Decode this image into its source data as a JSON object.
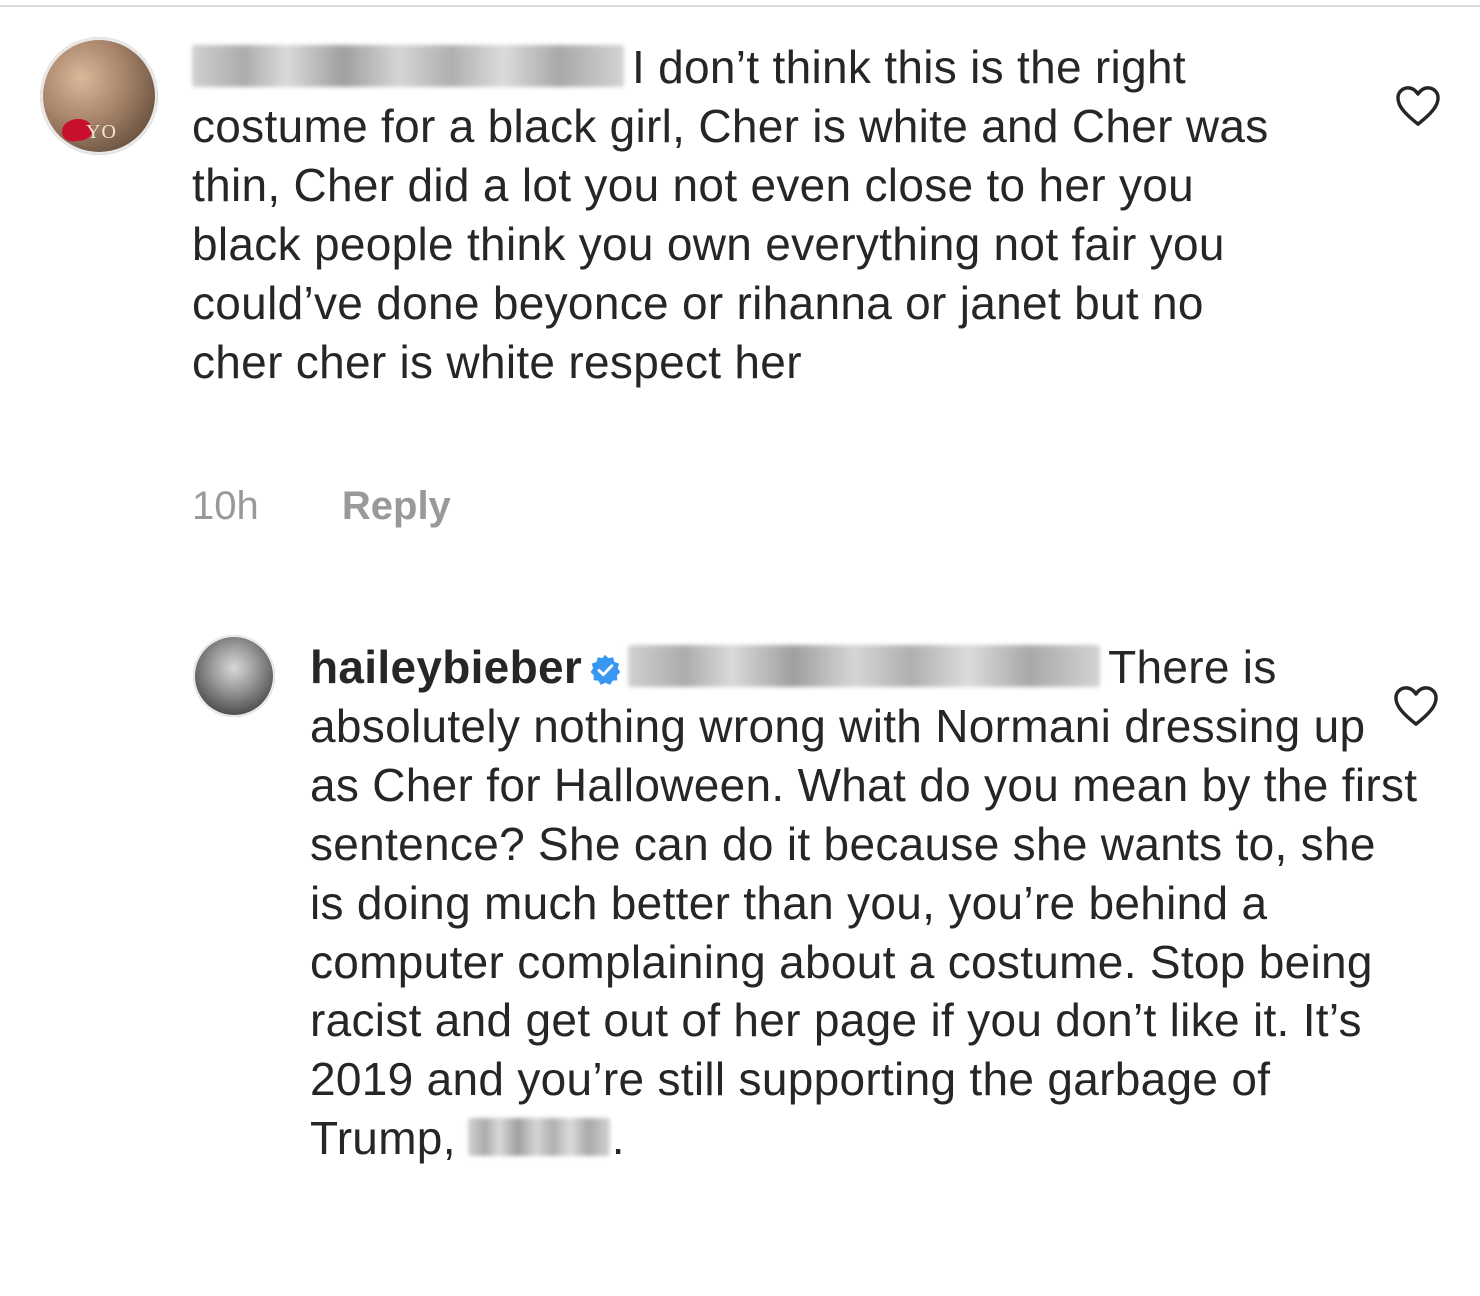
{
  "comments": [
    {
      "username_visible": "",
      "body": "I don’t think this is the right costume for a black girl, Cher is white and Cher was thin, Cher did a lot you not even close to her you black people think you own everything not fair you could’ve done beyonce or rihanna or janet but no cher cher is white respect her",
      "time": "10h",
      "reply_label": "Reply",
      "avatar_overlay_text": "YO"
    },
    {
      "username": "haileybieber",
      "verified": true,
      "body": "There is absolutely nothing wrong with Normani dressing up as Cher for Halloween. What do you mean by the first sentence? She can do it because she wants to, she is doing much better than you, you’re behind a computer complaining about a costume. Stop being racist and get out of her page if you don’t like it. It’s 2019 and you’re still supporting the garbage of Trump,",
      "body_end": "."
    }
  ],
  "colors": {
    "text": "#262626",
    "meta": "#999999",
    "verified": "#3897f0",
    "divider": "#dbdbdb"
  },
  "icons": [
    "heart-outline-icon",
    "verified-badge-icon"
  ]
}
